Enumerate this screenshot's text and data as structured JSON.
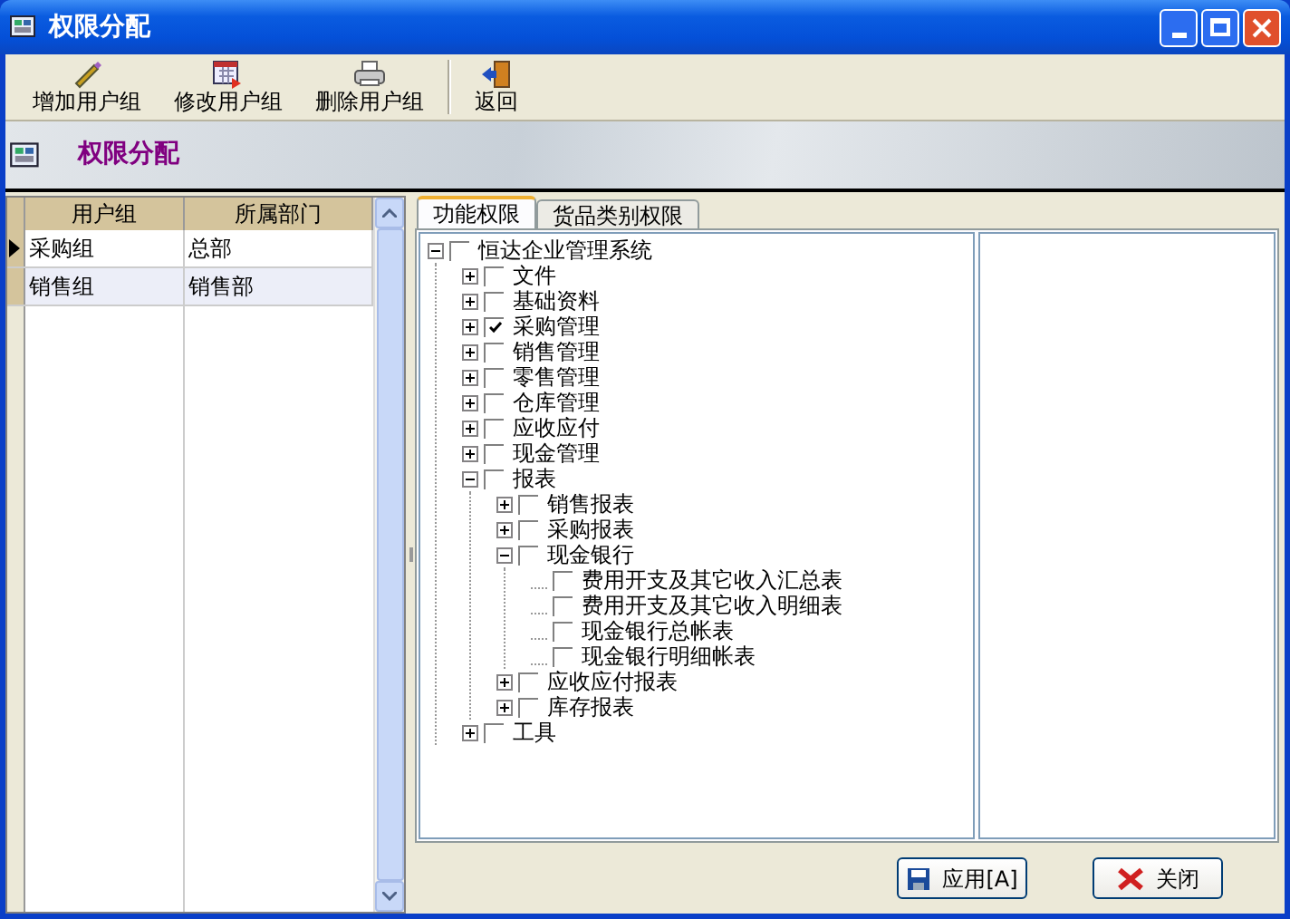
{
  "window": {
    "title": "权限分配"
  },
  "toolbar": [
    {
      "label": "增加用户组",
      "kind": "add"
    },
    {
      "label": "修改用户组",
      "kind": "edit"
    },
    {
      "label": "删除用户组",
      "kind": "delete"
    },
    {
      "label": "返回",
      "kind": "back"
    }
  ],
  "banner": {
    "title": "权限分配"
  },
  "table": {
    "columns": [
      "用户组",
      "所属部门"
    ],
    "rows": [
      {
        "cells": [
          "采购组",
          "总部"
        ],
        "selected": true
      },
      {
        "cells": [
          "销售组",
          "销售部"
        ],
        "selected": false
      }
    ]
  },
  "tabs": [
    {
      "label": "功能权限",
      "selected": true
    },
    {
      "label": "货品类别权限",
      "selected": false
    }
  ],
  "tree": [
    {
      "label": "恒达企业管理系统",
      "checked": false,
      "expanded": true,
      "children": [
        {
          "label": "文件",
          "checked": false,
          "expanded": false
        },
        {
          "label": "基础资料",
          "checked": false,
          "expanded": false
        },
        {
          "label": "采购管理",
          "checked": true,
          "expanded": false
        },
        {
          "label": "销售管理",
          "checked": false,
          "expanded": false
        },
        {
          "label": "零售管理",
          "checked": false,
          "expanded": false
        },
        {
          "label": "仓库管理",
          "checked": false,
          "expanded": false
        },
        {
          "label": "应收应付",
          "checked": false,
          "expanded": false
        },
        {
          "label": "现金管理",
          "checked": false,
          "expanded": false
        },
        {
          "label": "报表",
          "checked": false,
          "expanded": true,
          "children": [
            {
              "label": "销售报表",
              "checked": false,
              "expanded": false
            },
            {
              "label": "采购报表",
              "checked": false,
              "expanded": false
            },
            {
              "label": "现金银行",
              "checked": false,
              "expanded": true,
              "children": [
                {
                  "label": "费用开支及其它收入汇总表",
                  "checked": false
                },
                {
                  "label": "费用开支及其它收入明细表",
                  "checked": false
                },
                {
                  "label": "现金银行总帐表",
                  "checked": false
                },
                {
                  "label": "现金银行明细帐表",
                  "checked": false
                }
              ]
            },
            {
              "label": "应收应付报表",
              "checked": false,
              "expanded": false
            },
            {
              "label": "库存报表",
              "checked": false,
              "expanded": false
            }
          ]
        },
        {
          "label": "工具",
          "checked": false,
          "expanded": false
        }
      ]
    }
  ],
  "buttons": [
    {
      "label": "应用[A]",
      "kind": "apply"
    },
    {
      "label": "关闭",
      "kind": "close"
    }
  ]
}
